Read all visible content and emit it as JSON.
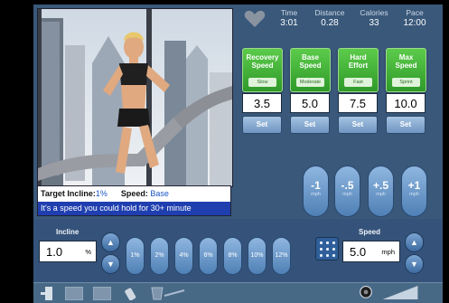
{
  "caption": {
    "incline_label": "Target Incline:",
    "incline_value": "1%",
    "speed_label": "Speed:",
    "speed_value": "Base",
    "message": "It's a speed you could hold for 30+ minute"
  },
  "stats": [
    {
      "label": "Time",
      "value": "3:01"
    },
    {
      "label": "Distance",
      "value": "0.28"
    },
    {
      "label": "Calories",
      "value": "33"
    },
    {
      "label": "Pace",
      "value": "12:00"
    }
  ],
  "presets": [
    {
      "line1": "Recovery",
      "line2": "Speed",
      "sub": "Slow",
      "value": "3.5",
      "set_label": "Set"
    },
    {
      "line1": "Base",
      "line2": "Speed",
      "sub": "Moderate",
      "value": "5.0",
      "set_label": "Set"
    },
    {
      "line1": "Hard",
      "line2": "Effort",
      "sub": "Fast",
      "value": "7.5",
      "set_label": "Set"
    },
    {
      "line1": "Max",
      "line2": "Speed",
      "sub": "Sprint",
      "value": "10.0",
      "set_label": "Set"
    }
  ],
  "increments": [
    {
      "label": "-1",
      "unit": "mph"
    },
    {
      "label": "-.5",
      "unit": "mph"
    },
    {
      "label": "+.5",
      "unit": "mph"
    },
    {
      "label": "+1",
      "unit": "mph"
    }
  ],
  "incline": {
    "title": "Incline",
    "value": "1.0",
    "unit": "%",
    "presets": [
      "1%",
      "2%",
      "4%",
      "6%",
      "8%",
      "10%",
      "12%"
    ]
  },
  "speed": {
    "title": "Speed",
    "value": "5.0",
    "unit": "mph"
  },
  "colors": {
    "panel": "#39587a",
    "preset_green": "#3faa33",
    "accent_blue": "#1f3fb0"
  }
}
